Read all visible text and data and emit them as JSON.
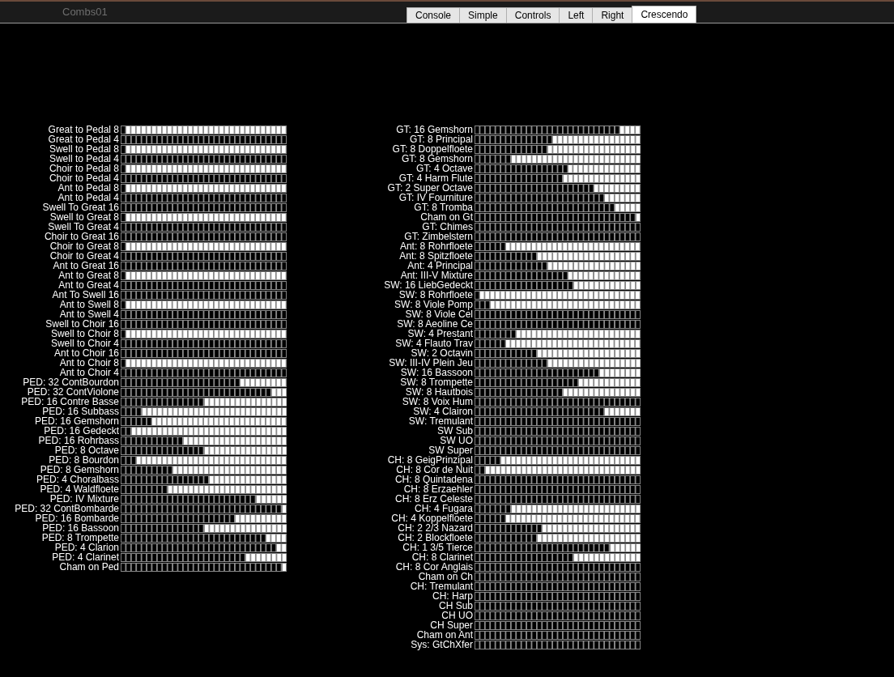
{
  "window": {
    "title": "Combs01"
  },
  "tabs": [
    {
      "label": "Console",
      "selected": false
    },
    {
      "label": "Simple",
      "selected": false
    },
    {
      "label": "Controls",
      "selected": false
    },
    {
      "label": "Left",
      "selected": false
    },
    {
      "label": "Right",
      "selected": false
    },
    {
      "label": "Crescendo",
      "selected": true
    }
  ],
  "left_panel": {
    "stops": [
      {
        "name": "Great to Pedal 8",
        "level": 0.96875
      },
      {
        "name": "Great to Pedal 4",
        "level": 0
      },
      {
        "name": "Swell to Pedal 8",
        "level": 0.96875
      },
      {
        "name": "Swell to Pedal 4",
        "level": 0
      },
      {
        "name": "Choir to Pedal 8",
        "level": 0.96875
      },
      {
        "name": "Choir to Pedal 4",
        "level": 0
      },
      {
        "name": "Ant to Pedal 8",
        "level": 0.96875
      },
      {
        "name": "Ant to Pedal 4",
        "level": 0
      },
      {
        "name": "Swell To Great 16",
        "level": 0
      },
      {
        "name": "Swell to Great 8",
        "level": 0.96875
      },
      {
        "name": "Swell To Great 4",
        "level": 0
      },
      {
        "name": "Choir to Great 16",
        "level": 0
      },
      {
        "name": "Choir to Great 8",
        "level": 0.96875
      },
      {
        "name": "Choir to Great 4",
        "level": 0
      },
      {
        "name": "Ant to Great 16",
        "level": 0
      },
      {
        "name": "Ant to Great 8",
        "level": 0.96875
      },
      {
        "name": "Ant to Great 4",
        "level": 0
      },
      {
        "name": "Ant To Swell 16",
        "level": 0
      },
      {
        "name": "Ant to Swell 8",
        "level": 0.96875
      },
      {
        "name": "Ant to Swell 4",
        "level": 0
      },
      {
        "name": "Swell to Choir 16",
        "level": 0
      },
      {
        "name": "Swell to Choir 8",
        "level": 0.96875
      },
      {
        "name": "Swell to Choir 4",
        "level": 0
      },
      {
        "name": "Ant to Choir 16",
        "level": 0
      },
      {
        "name": "Ant to Choir 8",
        "level": 0.96875
      },
      {
        "name": "Ant to Choir 4",
        "level": 0
      },
      {
        "name": "PED: 32 ContBourdon",
        "level": 0.28125
      },
      {
        "name": "PED: 32 ContViolone",
        "level": 0.09375
      },
      {
        "name": "PED: 16 Contre Basse",
        "level": 0.5
      },
      {
        "name": "PED: 16 Subbass",
        "level": 0.875
      },
      {
        "name": "PED: 16 Gemshorn",
        "level": 0.8125
      },
      {
        "name": "PED: 16 Gedeckt",
        "level": 0.9375
      },
      {
        "name": "PED: 16 Rohrbass",
        "level": 0.625
      },
      {
        "name": "PED: 8 Octave",
        "level": 0.5
      },
      {
        "name": "PED: 8 Bourdon",
        "level": 0.90625
      },
      {
        "name": "PED: 8 Gemshorn",
        "level": 0.6875
      },
      {
        "name": "PED: 4 Choralbass",
        "level": 0.46875
      },
      {
        "name": "PED: 4 Waldfloete",
        "level": 0.71875
      },
      {
        "name": "PED: IV Mixture",
        "level": 0.1875
      },
      {
        "name": "PED: 32 ContBombarde",
        "level": 0.03125
      },
      {
        "name": "PED: 16 Bombarde",
        "level": 0.3125
      },
      {
        "name": "PED: 16 Bassoon",
        "level": 0.5
      },
      {
        "name": "PED: 8 Trompette",
        "level": 0.125
      },
      {
        "name": "PED: 4 Clarion",
        "level": 0.0625
      },
      {
        "name": "PED: 4 Clarinet",
        "level": 0.25
      },
      {
        "name": "Cham on Ped",
        "level": 0.03125
      }
    ]
  },
  "right_panel": {
    "stops": [
      {
        "name": "GT: 16 Gemshorn",
        "level": 0.125
      },
      {
        "name": "GT: 8 Principal",
        "level": 0.53125
      },
      {
        "name": "GT: 8 Doppelfloete",
        "level": 0.5625
      },
      {
        "name": "GT: 8 Gemshorn",
        "level": 0.78125
      },
      {
        "name": "GT: 4 Octave",
        "level": 0.4375
      },
      {
        "name": "GT: 4 Harm Flute",
        "level": 0.46875
      },
      {
        "name": "GT: 2 Super Octave",
        "level": 0.28125
      },
      {
        "name": "GT: IV Fourniture",
        "level": 0.21875
      },
      {
        "name": "GT: 8 Tromba",
        "level": 0.15625
      },
      {
        "name": "Cham on Gt",
        "level": 0.03125
      },
      {
        "name": "GT: Chimes",
        "level": 0
      },
      {
        "name": "GT: Zimbelstern",
        "level": 0
      },
      {
        "name": "Ant: 8 Rohrfloete",
        "level": 0.8125
      },
      {
        "name": "Ant: 8 Spitzfloete",
        "level": 0.625
      },
      {
        "name": "Ant: 4 Principal",
        "level": 0.5625
      },
      {
        "name": "Ant: III-V Mixture",
        "level": 0.4375
      },
      {
        "name": "SW: 16 LiebGedeckt",
        "level": 0.40625
      },
      {
        "name": "SW: 8 Rohrfloete",
        "level": 0.96875
      },
      {
        "name": "SW: 8 Viole Pomp",
        "level": 0.90625
      },
      {
        "name": "SW: 8 Viole Cel",
        "level": 0
      },
      {
        "name": "SW: 8 Aeoline Ce",
        "level": 0
      },
      {
        "name": "SW: 4 Prestant",
        "level": 0.75
      },
      {
        "name": "SW: 4 Flauto Trav",
        "level": 0.8125
      },
      {
        "name": "SW: 2 Octavin",
        "level": 0.625
      },
      {
        "name": "SW: III-IV Plein Jeu",
        "level": 0.5625
      },
      {
        "name": "SW: 16 Bassoon",
        "level": 0.25
      },
      {
        "name": "SW: 8 Trompette",
        "level": 0.375
      },
      {
        "name": "SW: 8 Hautbois",
        "level": 0.46875
      },
      {
        "name": "SW: 8 Voix Hum",
        "level": 0
      },
      {
        "name": "SW: 4 Clairon",
        "level": 0.21875
      },
      {
        "name": "SW: Tremulant",
        "level": 0
      },
      {
        "name": "SW Sub",
        "level": 0
      },
      {
        "name": "SW UO",
        "level": 0
      },
      {
        "name": "SW Super",
        "level": 0
      },
      {
        "name": "CH: 8 GeigPrinzipal",
        "level": 0.84375
      },
      {
        "name": "CH: 8 Cor de Nuit",
        "level": 0.9375
      },
      {
        "name": "CH: 8 Quintadena",
        "level": 0
      },
      {
        "name": "CH: 8 Erzaehler",
        "level": 0
      },
      {
        "name": "CH: 8 Erz Celeste",
        "level": 0
      },
      {
        "name": "CH: 4 Fugara",
        "level": 0.78125
      },
      {
        "name": "CH: 4 Koppelfloete",
        "level": 0.8125
      },
      {
        "name": "CH: 2 2/3 Nazard",
        "level": 0.59375
      },
      {
        "name": "CH: 2 Blockfloete",
        "level": 0.625
      },
      {
        "name": "CH: 1 3/5 Tierce",
        "level": 0.1875
      },
      {
        "name": "CH: 8 Clarinet",
        "level": 0.40625
      },
      {
        "name": "CH: 8 Cor Anglais",
        "level": 0
      },
      {
        "name": "Cham on Ch",
        "level": 0
      },
      {
        "name": "CH: Tremulant",
        "level": 0
      },
      {
        "name": "CH: Harp",
        "level": 0
      },
      {
        "name": "CH Sub",
        "level": 0
      },
      {
        "name": "CH UO",
        "level": 0
      },
      {
        "name": "CH Super",
        "level": 0
      },
      {
        "name": "Cham on Ant",
        "level": 0
      },
      {
        "name": "Sys: GtChXfer",
        "level": 0
      }
    ]
  }
}
